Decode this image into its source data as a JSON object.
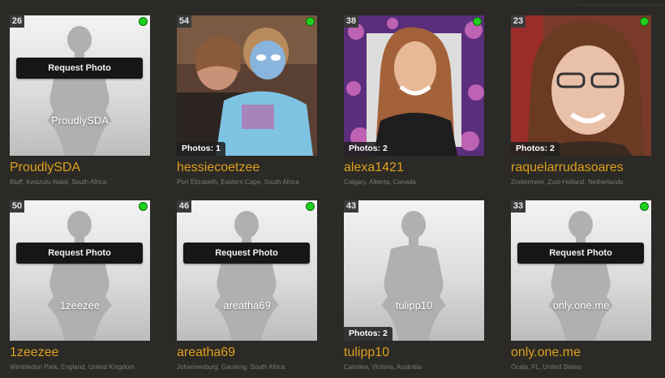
{
  "request_label": "Request Photo",
  "profiles": [
    {
      "age": "26",
      "username": "ProudlySDA",
      "location": "Bluff, Kwazulu-Natal, South Africa",
      "photos": "",
      "online": true,
      "has_photo": false
    },
    {
      "age": "54",
      "username": "hessiecoetzee",
      "location": "Port Elizabeth, Eastern Cape, South Africa",
      "photos": "Photos: 1",
      "online": true,
      "has_photo": true
    },
    {
      "age": "38",
      "username": "alexa1421",
      "location": "Calgary, Alberta, Canada",
      "photos": "Photos: 2",
      "online": true,
      "has_photo": true
    },
    {
      "age": "23",
      "username": "raquelarrudasoares",
      "location": "Zoetermeer, Zuid-Holland, Netherlands",
      "photos": "Photos: 2",
      "online": true,
      "has_photo": true
    },
    {
      "age": "50",
      "username": "1zeezee",
      "location": "Wimbledon Park, England, United Kingdom",
      "photos": "",
      "online": true,
      "has_photo": false
    },
    {
      "age": "46",
      "username": "areatha69",
      "location": "Johannesburg, Gauteng, South Africa",
      "photos": "",
      "online": true,
      "has_photo": false
    },
    {
      "age": "43",
      "username": "tulipp10",
      "location": "Cairnlea, Victoria, Australia",
      "photos": "Photos: 2",
      "online": false,
      "has_photo": false
    },
    {
      "age": "33",
      "username": "only.one.me",
      "location": "Ocala, FL, United States",
      "photos": "",
      "online": true,
      "has_photo": false
    }
  ],
  "colors": {
    "background": "#2b2a26",
    "username": "#e0a01c",
    "online": "#1fd11f",
    "location": "#7c7a74"
  }
}
